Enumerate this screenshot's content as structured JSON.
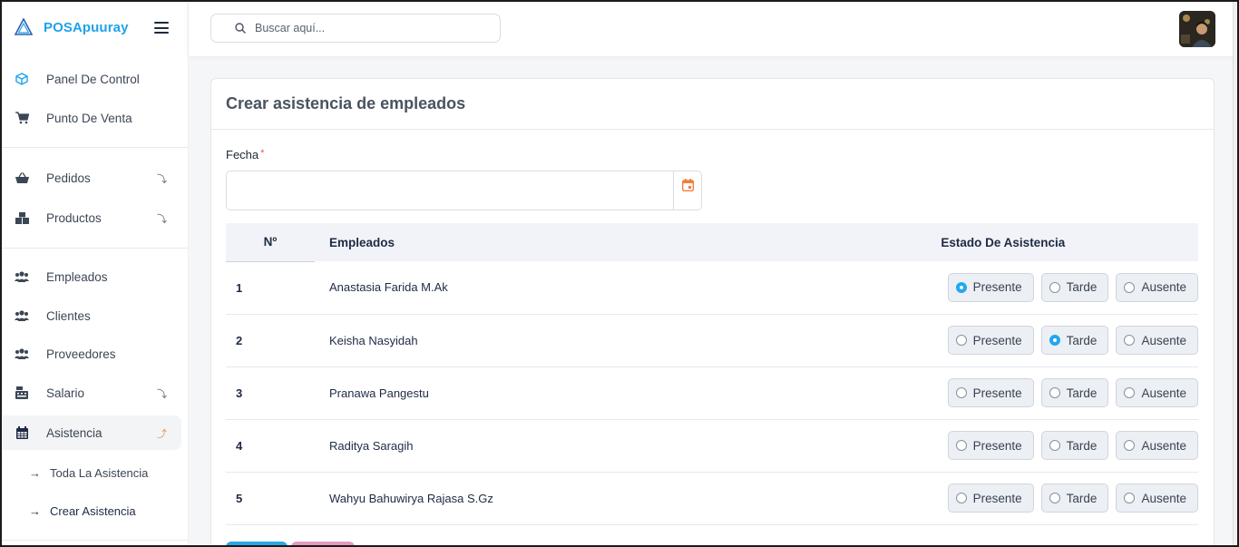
{
  "app": {
    "name": "POSApuuray"
  },
  "search": {
    "placeholder": "Buscar aquí..."
  },
  "sidebar": {
    "items": [
      {
        "label": "Panel De Control",
        "icon": "cube-icon"
      },
      {
        "label": "Punto De Venta",
        "icon": "cart-icon"
      },
      {
        "label": "Pedidos",
        "icon": "basket-icon",
        "expandable": true
      },
      {
        "label": "Productos",
        "icon": "boxes-icon",
        "expandable": true
      },
      {
        "label": "Empleados",
        "icon": "users-icon"
      },
      {
        "label": "Clientes",
        "icon": "users-icon"
      },
      {
        "label": "Proveedores",
        "icon": "users-icon"
      },
      {
        "label": "Salario",
        "icon": "cash-register-icon",
        "expandable": true
      },
      {
        "label": "Asistencia",
        "icon": "calendar-icon",
        "expandable": true,
        "active": true
      }
    ],
    "subitems": [
      {
        "label": "Toda La Asistencia"
      },
      {
        "label": "Crear Asistencia"
      }
    ]
  },
  "form": {
    "title": "Crear asistencia de empleados",
    "date_label": "Fecha",
    "required_mark": "*",
    "date_value": ""
  },
  "table": {
    "headers": {
      "num": "Nº",
      "employees": "Empleados",
      "status": "Estado De Asistencia"
    },
    "options": [
      "Presente",
      "Tarde",
      "Ausente"
    ],
    "rows": [
      {
        "n": "1",
        "name": "Anastasia Farida M.Ak",
        "selected": "Presente"
      },
      {
        "n": "2",
        "name": "Keisha Nasyidah",
        "selected": "Tarde"
      },
      {
        "n": "3",
        "name": "Pranawa Pangestu",
        "selected": ""
      },
      {
        "n": "4",
        "name": "Raditya Saragih",
        "selected": ""
      },
      {
        "n": "5",
        "name": "Wahyu Bahuwirya Rajasa S.Gz",
        "selected": ""
      }
    ]
  },
  "colors": {
    "brand": "#1fa2ec",
    "accent_radio": "#23a6f0",
    "chevron_active": "#f28c3a",
    "calendar": "#f07f3c"
  }
}
